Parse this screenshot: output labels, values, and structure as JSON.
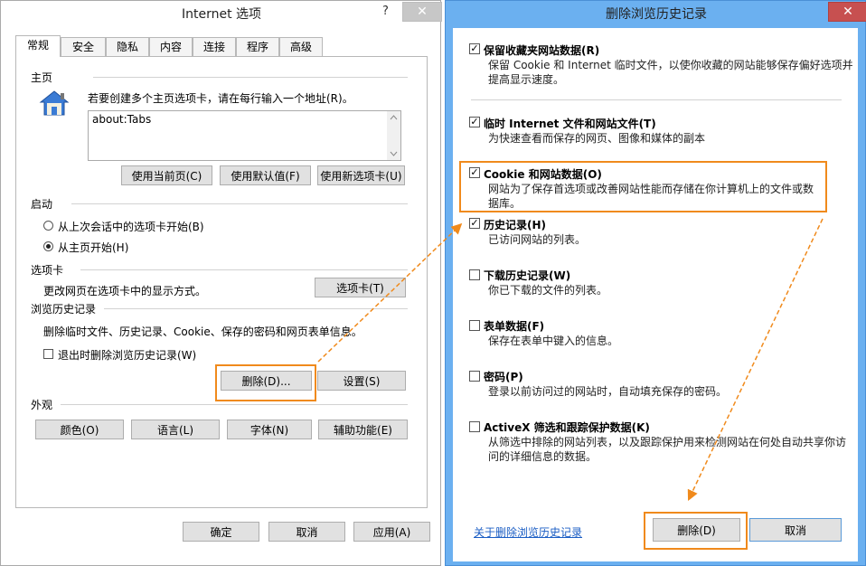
{
  "internet_options": {
    "title": "Internet 选项",
    "help": "?",
    "close": "✕",
    "tabs": [
      "常规",
      "安全",
      "隐私",
      "内容",
      "连接",
      "程序",
      "高级"
    ],
    "homepage": {
      "heading": "主页",
      "desc": "若要创建多个主页选项卡，请在每行输入一个地址(R)。",
      "value": "about:Tabs",
      "buttons": [
        "使用当前页(C)",
        "使用默认值(F)",
        "使用新选项卡(U)"
      ]
    },
    "startup": {
      "heading": "启动",
      "options": [
        "从上次会话中的选项卡开始(B)",
        "从主页开始(H)"
      ]
    },
    "tabs_section": {
      "heading": "选项卡",
      "desc": "更改网页在选项卡中的显示方式。",
      "button": "选项卡(T)"
    },
    "history": {
      "heading": "浏览历史记录",
      "desc": "删除临时文件、历史记录、Cookie、保存的密码和网页表单信息。",
      "checkbox": "退出时删除浏览历史记录(W)",
      "delete_button": "删除(D)...",
      "settings_button": "设置(S)"
    },
    "appearance": {
      "heading": "外观",
      "buttons": [
        "颜色(O)",
        "语言(L)",
        "字体(N)",
        "辅助功能(E)"
      ]
    },
    "footer": [
      "确定",
      "取消",
      "应用(A)"
    ]
  },
  "delete_history": {
    "title": "删除浏览历史记录",
    "close": "✕",
    "items": [
      {
        "title": "保留收藏夹网站数据(R)",
        "desc": "保留 Cookie 和 Internet 临时文件，以使你收藏的网站能够保存偏好选项并提高显示速度。",
        "checked": true
      },
      {
        "title": "临时 Internet 文件和网站文件(T)",
        "desc": "为快速查看而保存的网页、图像和媒体的副本",
        "checked": true
      },
      {
        "title": "Cookie 和网站数据(O)",
        "desc": "网站为了保存首选项或改善网站性能而存储在你计算机上的文件或数据库。",
        "checked": true
      },
      {
        "title": "历史记录(H)",
        "desc": "已访问网站的列表。",
        "checked": true
      },
      {
        "title": "下载历史记录(W)",
        "desc": "你已下载的文件的列表。",
        "checked": false
      },
      {
        "title": "表单数据(F)",
        "desc": "保存在表单中键入的信息。",
        "checked": false
      },
      {
        "title": "密码(P)",
        "desc": "登录以前访问过的网站时，自动填充保存的密码。",
        "checked": false
      },
      {
        "title": "ActiveX 筛选和跟踪保护数据(K)",
        "desc": "从筛选中排除的网站列表，以及跟踪保护用来检测网站在何处自动共享你访问的详细信息的数据。",
        "checked": false
      }
    ],
    "link": "关于删除浏览历史记录",
    "delete_button": "删除(D)",
    "cancel_button": "取消",
    "check_glyph": "✓"
  },
  "colors": {
    "highlight": "#f08a1c",
    "accent_frame": "#6bb0f0",
    "close_red": "#c75050"
  }
}
